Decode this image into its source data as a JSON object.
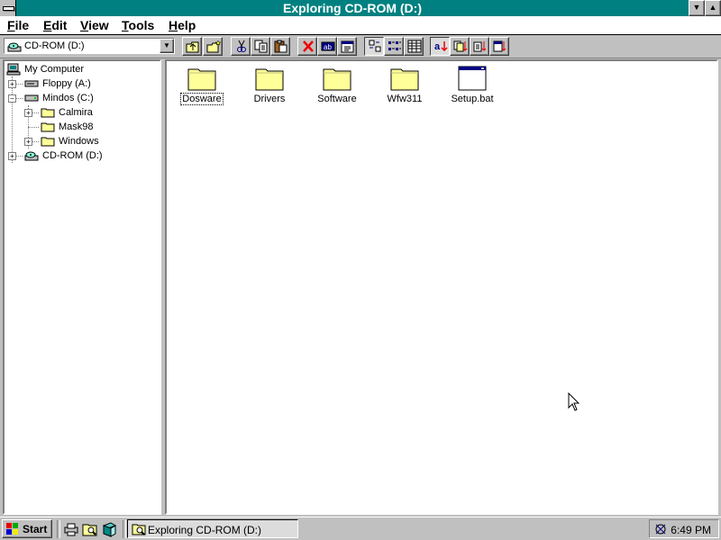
{
  "window": {
    "title": "Exploring CD-ROM (D:)"
  },
  "menu": [
    {
      "label": "File",
      "hot": "F",
      "rest": "ile"
    },
    {
      "label": "Edit",
      "hot": "E",
      "rest": "dit"
    },
    {
      "label": "View",
      "hot": "V",
      "rest": "iew"
    },
    {
      "label": "Tools",
      "hot": "T",
      "rest": "ools"
    },
    {
      "label": "Help",
      "hot": "H",
      "rest": "elp"
    }
  ],
  "toolbar": {
    "drive_value": "CD-ROM (D:)",
    "buttons": [
      "up-one-level",
      "map-network-drive",
      "cut",
      "copy",
      "paste",
      "delete",
      "rename",
      "properties",
      "large-icons",
      "small-icons",
      "list",
      "details",
      "sort-by-name",
      "sort-by-type",
      "sort-by-size",
      "sort-by-date"
    ]
  },
  "tree": {
    "items": [
      {
        "label": "My Computer",
        "icon": "computer-icon"
      },
      {
        "label": "Floppy (A:)",
        "icon": "floppy-drive-icon"
      },
      {
        "label": "Mindos (C:)",
        "icon": "hard-drive-icon"
      },
      {
        "label": "Calmira",
        "icon": "folder-icon"
      },
      {
        "label": "Mask98",
        "icon": "folder-icon"
      },
      {
        "label": "Windows",
        "icon": "folder-icon"
      },
      {
        "label": "CD-ROM (D:)",
        "icon": "cd-drive-icon"
      }
    ]
  },
  "files": [
    {
      "name": "Dosware",
      "type": "folder"
    },
    {
      "name": "Drivers",
      "type": "folder"
    },
    {
      "name": "Software",
      "type": "folder"
    },
    {
      "name": "Wfw311",
      "type": "folder"
    },
    {
      "name": "Setup.bat",
      "type": "batch"
    }
  ],
  "taskbar": {
    "start_label": "Start",
    "task_label": "Exploring CD-ROM (D:)",
    "clock": "6:49 PM"
  },
  "colors": {
    "titlebar": "#008080",
    "folder": "#ffff99",
    "face": "#c0c0c0"
  }
}
